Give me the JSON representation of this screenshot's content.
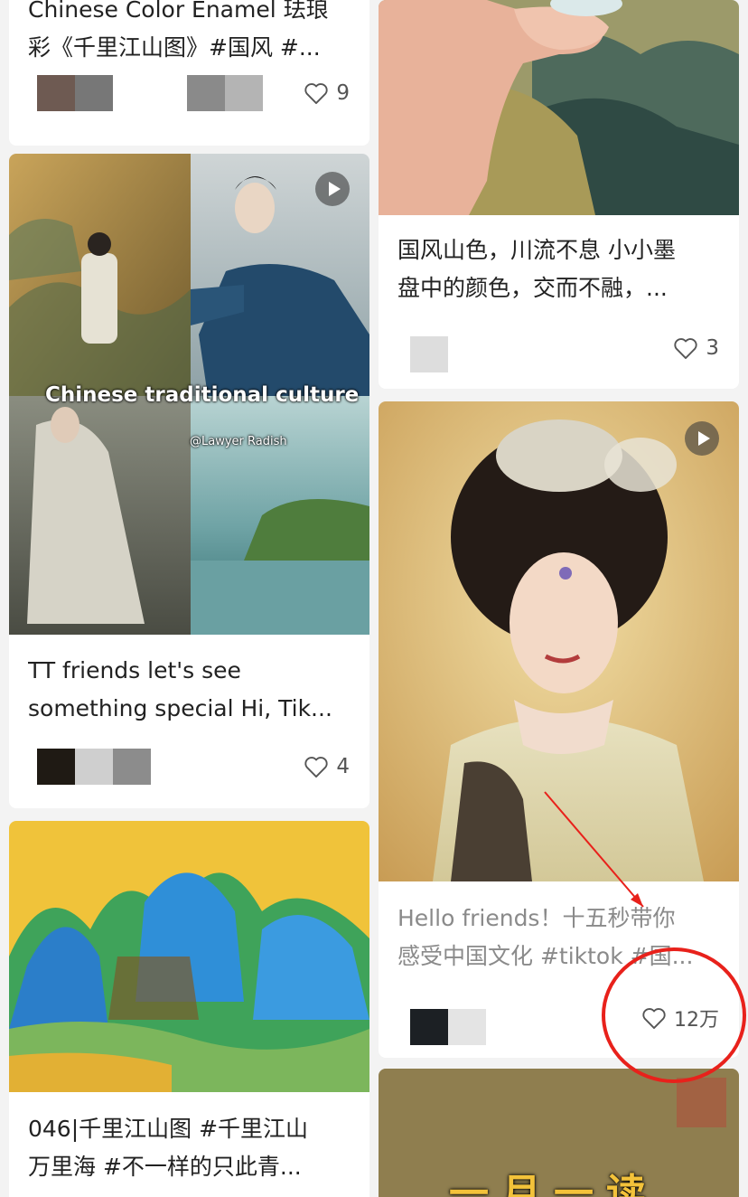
{
  "feed": {
    "left_cards": [
      {
        "title_line1": "Chinese Color Enamel 珐琅",
        "title_line2": "彩《千里江山图》#国风  #...",
        "likes": "9",
        "avatar_colors": [
          "#6e5a52",
          "#777777",
          "#ffffff",
          "#8a8a8a",
          "#b4b4b4"
        ]
      },
      {
        "title_line1": "TT friends let's see",
        "title_line2": "something special Hi, Tik...",
        "likes": "4",
        "avatar_colors": [
          "#1f1a14",
          "#cfcfcf",
          "#8c8c8c"
        ],
        "overlay_caption": "Chinese traditional culture",
        "overlay_handle": "@Lawyer Radish",
        "has_play": true
      },
      {
        "title_line1": "046|千里江山图 #千里江山",
        "title_line2": "万里海  #不一样的只此青..."
      }
    ],
    "right_cards": [
      {
        "title_line1": "国风山色，川流不息 小小墨",
        "title_line2": "盘中的颜色，交而不融，...",
        "likes": "3",
        "avatar_colors": [
          "#dddddd"
        ]
      },
      {
        "title_line1": "Hello friends！十五秒带你",
        "title_line2": "感受中国文化 #tiktok  #国...",
        "likes": "12万",
        "avatar_colors": [
          "#1c2024",
          "#e4e4e4"
        ],
        "has_play": true
      },
      {
        "banner_text": "一月一读"
      }
    ]
  },
  "colors": {
    "annotation_red": "#e8211b",
    "heart_stroke": "#555555"
  },
  "icons": {
    "like": "heart-outline-icon",
    "play": "play-icon"
  }
}
